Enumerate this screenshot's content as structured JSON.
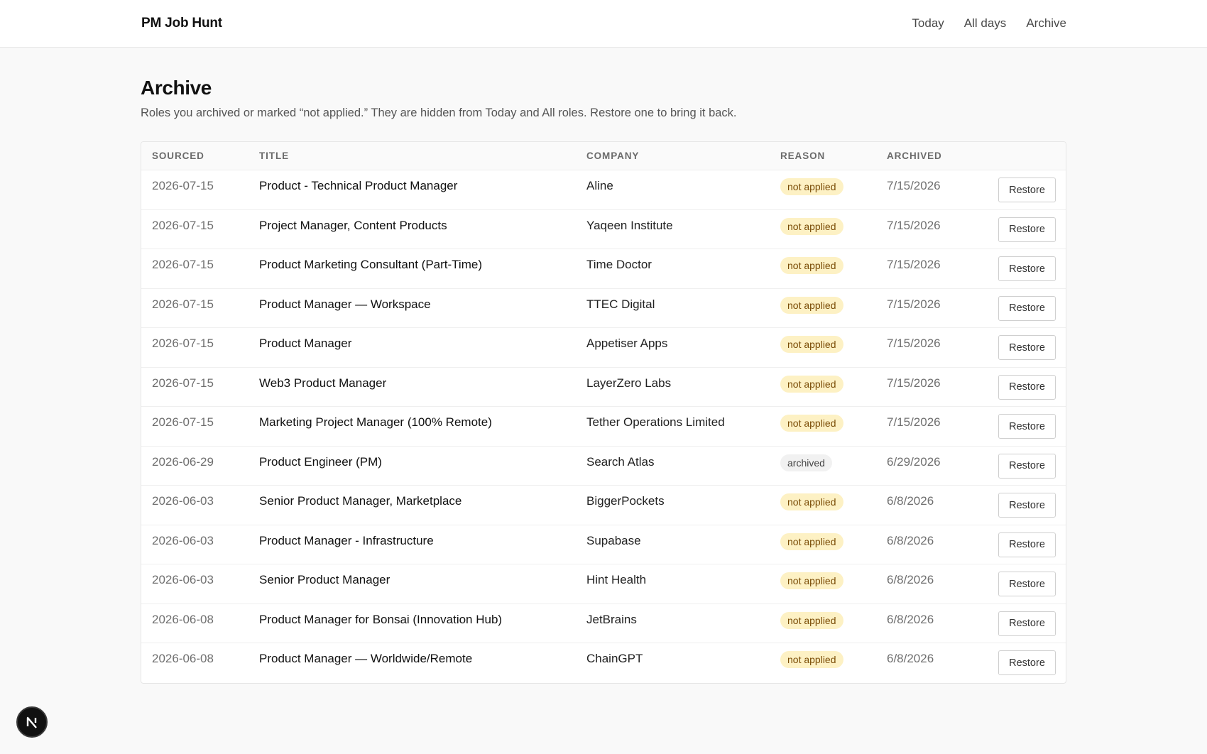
{
  "header": {
    "brand": "PM Job Hunt",
    "nav": [
      "Today",
      "All days",
      "Archive"
    ]
  },
  "page": {
    "title": "Archive",
    "subtitle": "Roles you archived or marked “not applied.” They are hidden from Today and All roles. Restore one to bring it back."
  },
  "table": {
    "columns": [
      "SOURCED",
      "TITLE",
      "COMPANY",
      "REASON",
      "ARCHIVED"
    ],
    "restore_label": "Restore",
    "rows": [
      {
        "sourced": "2026-07-15",
        "title": "Product - Technical Product Manager",
        "company": "Aline",
        "reason": "not applied",
        "archived": "7/15/2026"
      },
      {
        "sourced": "2026-07-15",
        "title": "Project Manager, Content Products",
        "company": "Yaqeen Institute",
        "reason": "not applied",
        "archived": "7/15/2026"
      },
      {
        "sourced": "2026-07-15",
        "title": "Product Marketing Consultant (Part-Time)",
        "company": "Time Doctor",
        "reason": "not applied",
        "archived": "7/15/2026"
      },
      {
        "sourced": "2026-07-15",
        "title": "Product Manager — Workspace",
        "company": "TTEC Digital",
        "reason": "not applied",
        "archived": "7/15/2026"
      },
      {
        "sourced": "2026-07-15",
        "title": "Product Manager",
        "company": "Appetiser Apps",
        "reason": "not applied",
        "archived": "7/15/2026"
      },
      {
        "sourced": "2026-07-15",
        "title": "Web3 Product Manager",
        "company": "LayerZero Labs",
        "reason": "not applied",
        "archived": "7/15/2026"
      },
      {
        "sourced": "2026-07-15",
        "title": "Marketing Project Manager (100% Remote)",
        "company": "Tether Operations Limited",
        "reason": "not applied",
        "archived": "7/15/2026"
      },
      {
        "sourced": "2026-06-29",
        "title": "Product Engineer (PM)",
        "company": "Search Atlas",
        "reason": "archived",
        "archived": "6/29/2026"
      },
      {
        "sourced": "2026-06-03",
        "title": "Senior Product Manager, Marketplace",
        "company": "BiggerPockets",
        "reason": "not applied",
        "archived": "6/8/2026"
      },
      {
        "sourced": "2026-06-03",
        "title": "Product Manager - Infrastructure",
        "company": "Supabase",
        "reason": "not applied",
        "archived": "6/8/2026"
      },
      {
        "sourced": "2026-06-03",
        "title": "Senior Product Manager",
        "company": "Hint Health",
        "reason": "not applied",
        "archived": "6/8/2026"
      },
      {
        "sourced": "2026-06-08",
        "title": "Product Manager for Bonsai (Innovation Hub)",
        "company": "JetBrains",
        "reason": "not applied",
        "archived": "6/8/2026"
      },
      {
        "sourced": "2026-06-08",
        "title": "Product Manager — Worldwide/Remote",
        "company": "ChainGPT",
        "reason": "not applied",
        "archived": "6/8/2026"
      }
    ]
  },
  "colors": {
    "badge_not_applied_bg": "#fdf1c4",
    "badge_not_applied_text": "#7a4c06",
    "badge_archived_bg": "#f1f1f1"
  },
  "icons": {
    "dev_badge": "nextjs-logo-icon"
  }
}
